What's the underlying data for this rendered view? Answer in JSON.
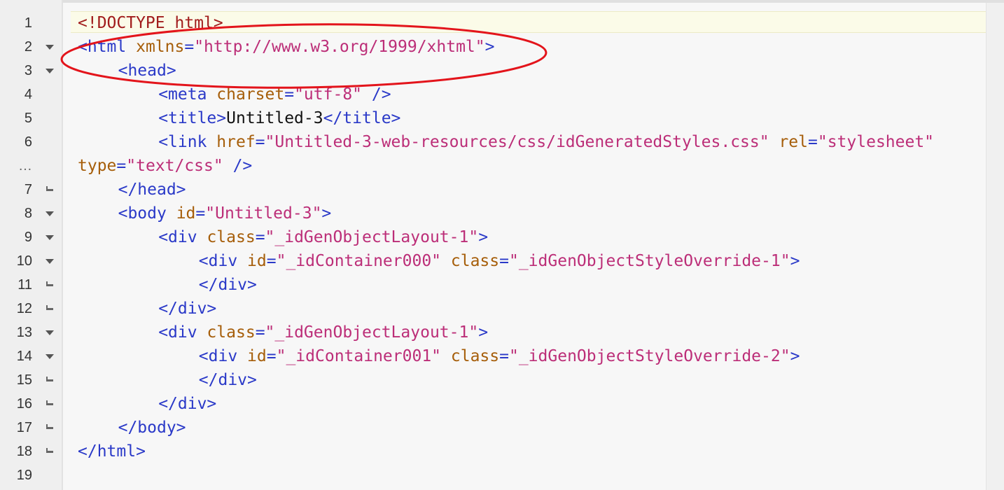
{
  "editor": {
    "active_line": 1,
    "lines": [
      {
        "number": "1",
        "fold": "none",
        "indent": 0,
        "tokens": [
          {
            "t": "doctype",
            "v": "<!DOCTYPE html>"
          }
        ]
      },
      {
        "number": "2",
        "fold": "open",
        "indent": 0,
        "tokens": [
          {
            "t": "tag",
            "v": "<html "
          },
          {
            "t": "attr",
            "v": "xmlns"
          },
          {
            "t": "tag",
            "v": "="
          },
          {
            "t": "str",
            "v": "\"http://www.w3.org/1999/xhtml\""
          },
          {
            "t": "tag",
            "v": ">"
          }
        ]
      },
      {
        "number": "3",
        "fold": "open",
        "indent": 1,
        "tokens": [
          {
            "t": "tag",
            "v": "<head>"
          }
        ]
      },
      {
        "number": "4",
        "fold": "none",
        "indent": 2,
        "tokens": [
          {
            "t": "tag",
            "v": "<meta "
          },
          {
            "t": "attr",
            "v": "charset"
          },
          {
            "t": "tag",
            "v": "="
          },
          {
            "t": "str",
            "v": "\"utf-8\""
          },
          {
            "t": "tag",
            "v": " />"
          }
        ]
      },
      {
        "number": "5",
        "fold": "none",
        "indent": 2,
        "tokens": [
          {
            "t": "tag",
            "v": "<title>"
          },
          {
            "t": "text",
            "v": "Untitled-3"
          },
          {
            "t": "tag",
            "v": "</title>"
          }
        ]
      },
      {
        "number": "6",
        "fold": "none",
        "indent": 2,
        "tokens": [
          {
            "t": "tag",
            "v": "<link "
          },
          {
            "t": "attr",
            "v": "href"
          },
          {
            "t": "tag",
            "v": "="
          },
          {
            "t": "str",
            "v": "\"Untitled-3-web-resources/css/idGeneratedStyles.css\""
          },
          {
            "t": "tag",
            "v": " "
          },
          {
            "t": "attr",
            "v": "rel"
          },
          {
            "t": "tag",
            "v": "="
          },
          {
            "t": "str",
            "v": "\"stylesheet\""
          }
        ]
      },
      {
        "number": "…",
        "fold": "none",
        "indent": 0,
        "cont": true,
        "tokens": [
          {
            "t": "attr",
            "v": "type"
          },
          {
            "t": "tag",
            "v": "="
          },
          {
            "t": "str",
            "v": "\"text/css\""
          },
          {
            "t": "tag",
            "v": " />"
          }
        ]
      },
      {
        "number": "7",
        "fold": "close",
        "indent": 1,
        "tokens": [
          {
            "t": "tag",
            "v": "</head>"
          }
        ]
      },
      {
        "number": "8",
        "fold": "open",
        "indent": 1,
        "tokens": [
          {
            "t": "tag",
            "v": "<body "
          },
          {
            "t": "attr",
            "v": "id"
          },
          {
            "t": "tag",
            "v": "="
          },
          {
            "t": "str",
            "v": "\"Untitled-3\""
          },
          {
            "t": "tag",
            "v": ">"
          }
        ]
      },
      {
        "number": "9",
        "fold": "open",
        "indent": 2,
        "tokens": [
          {
            "t": "tag",
            "v": "<div "
          },
          {
            "t": "attr",
            "v": "class"
          },
          {
            "t": "tag",
            "v": "="
          },
          {
            "t": "str",
            "v": "\"_idGenObjectLayout-1\""
          },
          {
            "t": "tag",
            "v": ">"
          }
        ]
      },
      {
        "number": "10",
        "fold": "open",
        "indent": 3,
        "tokens": [
          {
            "t": "tag",
            "v": "<div "
          },
          {
            "t": "attr",
            "v": "id"
          },
          {
            "t": "tag",
            "v": "="
          },
          {
            "t": "str",
            "v": "\"_idContainer000\""
          },
          {
            "t": "tag",
            "v": " "
          },
          {
            "t": "attr",
            "v": "class"
          },
          {
            "t": "tag",
            "v": "="
          },
          {
            "t": "str",
            "v": "\"_idGenObjectStyleOverride-1\""
          },
          {
            "t": "tag",
            "v": ">"
          }
        ]
      },
      {
        "number": "11",
        "fold": "close",
        "indent": 3,
        "tokens": [
          {
            "t": "tag",
            "v": "</div>"
          }
        ]
      },
      {
        "number": "12",
        "fold": "close",
        "indent": 2,
        "tokens": [
          {
            "t": "tag",
            "v": "</div>"
          }
        ]
      },
      {
        "number": "13",
        "fold": "open",
        "indent": 2,
        "tokens": [
          {
            "t": "tag",
            "v": "<div "
          },
          {
            "t": "attr",
            "v": "class"
          },
          {
            "t": "tag",
            "v": "="
          },
          {
            "t": "str",
            "v": "\"_idGenObjectLayout-1\""
          },
          {
            "t": "tag",
            "v": ">"
          }
        ]
      },
      {
        "number": "14",
        "fold": "open",
        "indent": 3,
        "tokens": [
          {
            "t": "tag",
            "v": "<div "
          },
          {
            "t": "attr",
            "v": "id"
          },
          {
            "t": "tag",
            "v": "="
          },
          {
            "t": "str",
            "v": "\"_idContainer001\""
          },
          {
            "t": "tag",
            "v": " "
          },
          {
            "t": "attr",
            "v": "class"
          },
          {
            "t": "tag",
            "v": "="
          },
          {
            "t": "str",
            "v": "\"_idGenObjectStyleOverride-2\""
          },
          {
            "t": "tag",
            "v": ">"
          }
        ]
      },
      {
        "number": "15",
        "fold": "close",
        "indent": 3,
        "tokens": [
          {
            "t": "tag",
            "v": "</div>"
          }
        ]
      },
      {
        "number": "16",
        "fold": "close",
        "indent": 2,
        "tokens": [
          {
            "t": "tag",
            "v": "</div>"
          }
        ]
      },
      {
        "number": "17",
        "fold": "close",
        "indent": 1,
        "tokens": [
          {
            "t": "tag",
            "v": "</body>"
          }
        ]
      },
      {
        "number": "18",
        "fold": "close",
        "indent": 0,
        "tokens": [
          {
            "t": "tag",
            "v": "</html>"
          }
        ]
      },
      {
        "number": "19",
        "fold": "none",
        "indent": 0,
        "tokens": []
      }
    ]
  },
  "annotation": {
    "shape": "ellipse",
    "color": "#e3141b",
    "target_line": 2
  },
  "colors": {
    "doctype": "#a11c1c",
    "tag": "#2a39c8",
    "attribute": "#a65e0a",
    "string": "#bc2e78",
    "text": "#111111",
    "annotation": "#e3141b"
  }
}
